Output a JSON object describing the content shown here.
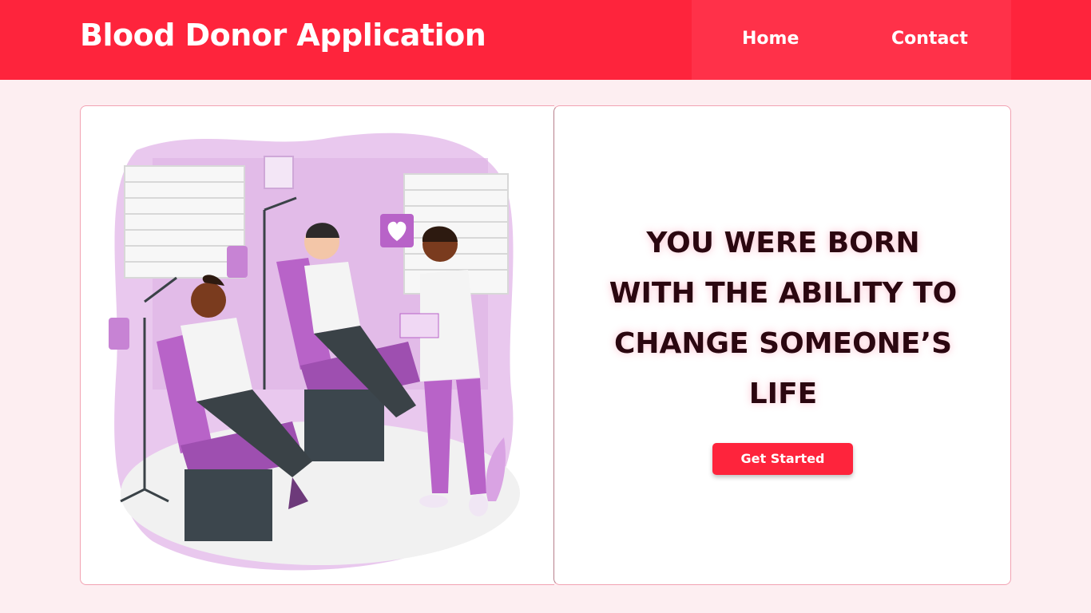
{
  "header": {
    "title": "Blood Donor Application",
    "nav": [
      {
        "label": "Home"
      },
      {
        "label": "Contact"
      }
    ]
  },
  "hero": {
    "headline_lines": [
      "YOU WERE BORN",
      "WITH THE ABILITY TO",
      "CHANGE SOMEONE’S",
      "LIFE"
    ],
    "cta_label": "Get Started"
  },
  "colors": {
    "brand_red": "#fe243c",
    "nav_bg": "#ff3149",
    "page_bg": "#fdeef1",
    "headline": "#2b0710",
    "illustration_purple": "#b863c8"
  },
  "illustration": {
    "icon": "blood-donation-illustration"
  }
}
